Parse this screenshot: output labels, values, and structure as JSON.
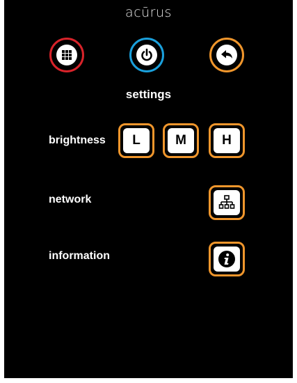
{
  "brand": {
    "logo_text": "acūrus"
  },
  "colors": {
    "apps_ring": "#d8232a",
    "power_ring": "#1aa0dc",
    "back_ring": "#f0962c",
    "button_outline": "#f0962c"
  },
  "header": {
    "apps_icon": "grid-icon",
    "power_icon": "power-icon",
    "back_icon": "back-arrow-icon"
  },
  "page": {
    "title": "settings"
  },
  "brightness": {
    "label": "brightness",
    "options": [
      "L",
      "M",
      "H"
    ]
  },
  "network": {
    "label": "network",
    "icon": "network-icon"
  },
  "information": {
    "label": "information",
    "icon": "info-icon"
  }
}
